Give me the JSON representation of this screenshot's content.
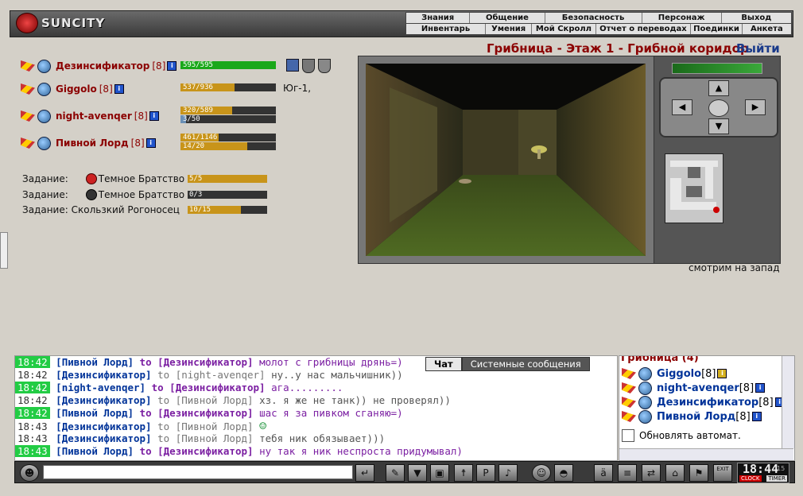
{
  "logo": {
    "text": "SUNCITY"
  },
  "menu": {
    "row1": [
      "Знания",
      "Общение",
      "Безопасность",
      "Персонаж",
      "Выход"
    ],
    "row2": [
      "Инвентарь",
      "Умения",
      "Мой Скролл",
      "Отчет о переводах",
      "Поединки",
      "Анкета"
    ]
  },
  "players": [
    {
      "name": "Дезинсификатор",
      "level": "[8]",
      "hp_text": "595/595",
      "hp_fill": 1.0,
      "hp_color": "#1aa81a"
    },
    {
      "name": "Giggolo",
      "level": "[8]",
      "hp_text": "537/936",
      "hp_fill": 0.574,
      "hp_color": "#c8941a",
      "note": "Юг-1,"
    },
    {
      "name": "night-avenqer",
      "level": "[8]",
      "hp_text": "320/589",
      "hp_fill": 0.543,
      "hp_color": "#c8941a",
      "mana_text": "3/50",
      "mana_fill": 0.06
    },
    {
      "name": "Пивной Лорд",
      "level": "[8]",
      "hp_text": "461/1146",
      "hp_fill": 0.402,
      "hp_color": "#c8941a",
      "mana_text": "14/20",
      "mana_fill": 0.7
    }
  ],
  "quests": [
    {
      "label": "Задание:",
      "name": "Темное Братство",
      "progress": "5/5",
      "fill": 1.0
    },
    {
      "label": "Задание:",
      "name": "Темное Братство",
      "progress": "0/3",
      "fill": 0.0
    },
    {
      "label": "Задание:",
      "name": "Скользкий Рогоносец",
      "progress": "10/15",
      "fill": 0.667
    }
  ],
  "location": {
    "title": "Грибница - Этаж 1 - Грибной коридор",
    "exit": "Выйти",
    "direction": "смотрим на запад"
  },
  "chat": {
    "tabs": {
      "chat": "Чат",
      "system": "Системные сообщения"
    },
    "messages": [
      {
        "time": "18:42",
        "hi": true,
        "from": "[Пивной Лорд]",
        "to": "to [Дезинсификатор]",
        "text": "молот с грибницы дрянь=)",
        "private": true
      },
      {
        "time": "18:42",
        "hi": false,
        "from": "[Дезинсификатор]",
        "to": "to [night-avenqer]",
        "text": "ну..у нас мальчишник))",
        "private": false
      },
      {
        "time": "18:42",
        "hi": true,
        "from": "[night-avenqer]",
        "to": "to [Дезинсификатор]",
        "text": "ага.........",
        "private": true
      },
      {
        "time": "18:42",
        "hi": false,
        "from": "[Дезинсификатор]",
        "to": "to [Пивной Лорд]",
        "text": "хз. я же не танк)) не проверял))",
        "private": false
      },
      {
        "time": "18:42",
        "hi": true,
        "from": "[Пивной Лорд]",
        "to": "to [Дезинсификатор]",
        "text": "шас я за пивком сганяю=)",
        "private": true
      },
      {
        "time": "18:43",
        "hi": false,
        "from": "[Дезинсификатор]",
        "to": "to [Пивной Лорд]",
        "text": "",
        "smiley": true,
        "private": false
      },
      {
        "time": "18:43",
        "hi": false,
        "from": "[Дезинсификатор]",
        "to": "to [Пивной Лорд]",
        "text": "тебя ник обязывает)))",
        "private": false
      },
      {
        "time": "18:43",
        "hi": true,
        "from": "[Пивной Лорд]",
        "to": "to [Дезинсификатор]",
        "text": "ну так я ник неспроста придумывал)",
        "private": true
      }
    ]
  },
  "userlist": {
    "header": "Грибница (4)",
    "users": [
      {
        "name": "Giggolo",
        "level": "[8]"
      },
      {
        "name": "night-avenqer",
        "level": "[8]"
      },
      {
        "name": "Дезинсификатор",
        "level": "[8]"
      },
      {
        "name": "Пивной Лорд",
        "level": "[8]"
      }
    ],
    "auto_update": "Обновлять автомат."
  },
  "clock": {
    "time": "18:44",
    "seconds": "15",
    "clock_label": "CLOCK",
    "timer_label": "TIMER"
  },
  "toolbar": {
    "exit_label": "EXIT"
  }
}
